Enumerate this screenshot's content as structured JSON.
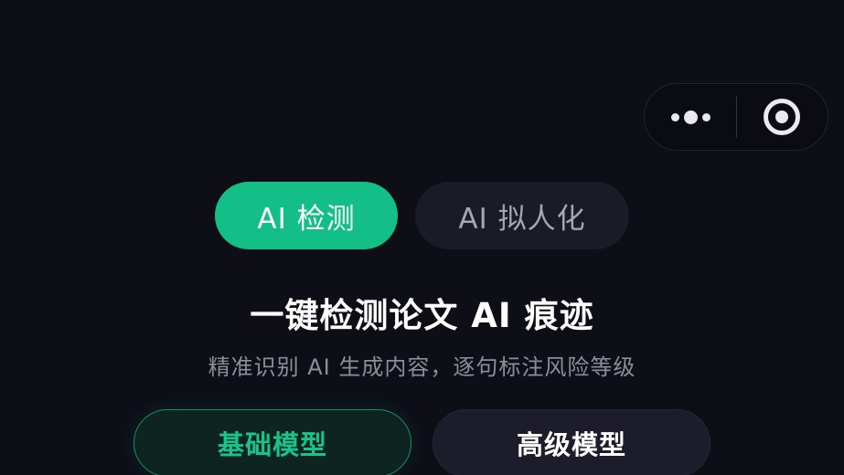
{
  "capsule": {
    "menu_icon": "more-dots-icon",
    "close_icon": "target-circle-icon"
  },
  "tabs": [
    {
      "label": "AI 检测",
      "active": true
    },
    {
      "label": "AI 拟人化",
      "active": false
    }
  ],
  "hero": {
    "title": "一键检测论文 AI 痕迹",
    "subtitle": "精准识别 AI 生成内容，逐句标注风险等级"
  },
  "models": [
    {
      "label": "基础模型",
      "selected": true
    },
    {
      "label": "高级模型",
      "selected": false
    }
  ],
  "colors": {
    "background": "#0e0e17",
    "accent": "#13bf86",
    "tab_inactive": "#1b1b28"
  }
}
